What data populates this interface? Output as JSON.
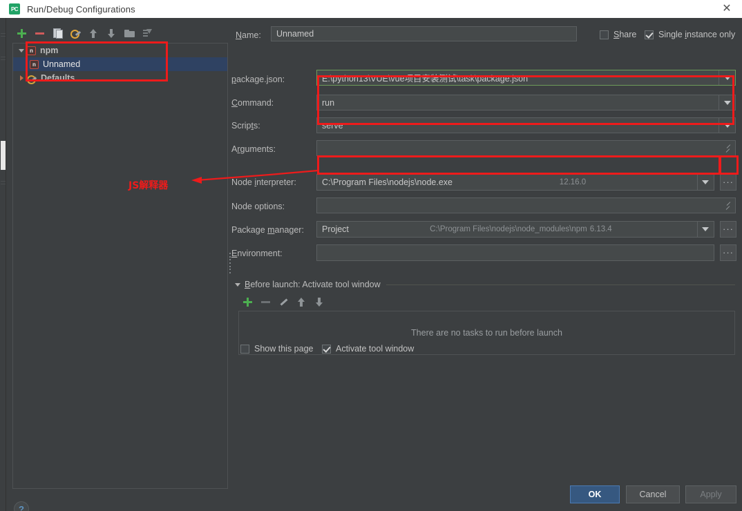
{
  "window": {
    "title": "Run/Debug Configurations",
    "app_icon": "pycharm-icon",
    "app_icon_text": "PC",
    "close_icon": "✕"
  },
  "left_panel": {
    "toolbar": [
      {
        "name": "add-configuration-button",
        "icon": "plus-icon"
      },
      {
        "name": "remove-configuration-button",
        "icon": "minus-icon"
      },
      {
        "name": "copy-configuration-button",
        "icon": "copy-icon"
      },
      {
        "name": "edit-defaults-button",
        "icon": "wrench-icon"
      },
      {
        "name": "move-up-button",
        "icon": "arrow-up-icon"
      },
      {
        "name": "move-down-button",
        "icon": "arrow-down-icon"
      },
      {
        "name": "new-folder-button",
        "icon": "folder-icon"
      },
      {
        "name": "sort-configurations-button",
        "icon": "sort-icon"
      }
    ],
    "tree": [
      {
        "label": "npm",
        "icon": "npm-icon",
        "expander": "caret-down-icon",
        "selected": false,
        "level": 0
      },
      {
        "label": "Unnamed",
        "icon": "npm-icon",
        "expander": "none",
        "selected": true,
        "level": 1
      },
      {
        "label": "Defaults",
        "icon": "defaults-wrench-icon",
        "expander": "caret-right-icon",
        "selected": false,
        "level": 0
      }
    ]
  },
  "form": {
    "name_label": "Name:",
    "name_label_mnemonic": "N",
    "name_value": "Unnamed",
    "share_label": "Share",
    "share_checked": false,
    "single_instance_label": "Single instance only",
    "single_instance_checked": true,
    "rows": [
      {
        "label": "package.json:",
        "mnemonic": "p",
        "value": "E:\\python13\\VUE\\vue项目安装测试\\task\\package.json",
        "hint": "",
        "control": "combo"
      },
      {
        "label": "Command:",
        "mnemonic": "C",
        "value": "run",
        "hint": "",
        "control": "combo"
      },
      {
        "label": "Scripts:",
        "mnemonic": "t",
        "value": "serve",
        "hint": "",
        "control": "combo"
      },
      {
        "label": "Arguments:",
        "mnemonic": "r",
        "value": "",
        "hint": "",
        "control": "expandable"
      },
      {
        "label": "Node interpreter:",
        "mnemonic": "i",
        "value": "C:\\Program Files\\nodejs\\node.exe",
        "hint": "12.16.0",
        "control": "combo-browse"
      },
      {
        "label": "Node options:",
        "mnemonic": "",
        "value": "",
        "hint": "",
        "control": "expandable"
      },
      {
        "label": "Package manager:",
        "mnemonic": "m",
        "value": "Project",
        "hint": "C:\\Program Files\\nodejs\\node_modules\\npm",
        "hint2": "6.13.4",
        "control": "combo-browse"
      },
      {
        "label": "Environment:",
        "mnemonic": "E",
        "value": "",
        "hint": "",
        "control": "browse"
      }
    ]
  },
  "before_launch": {
    "title": "Before launch: Activate tool window",
    "title_mnemonic": "B",
    "toolbar": [
      {
        "name": "add-task-button",
        "icon": "plus-icon"
      },
      {
        "name": "remove-task-button",
        "icon": "minus-icon"
      },
      {
        "name": "edit-task-button",
        "icon": "pencil-icon"
      },
      {
        "name": "move-task-up-button",
        "icon": "arrow-up-icon"
      },
      {
        "name": "move-task-down-button",
        "icon": "arrow-down-icon"
      }
    ],
    "empty_text": "There are no tasks to run before launch",
    "show_page_label": "Show this page",
    "show_page_checked": false,
    "activate_tool_window_label": "Activate tool window",
    "activate_tool_window_checked": true
  },
  "footer": {
    "help_icon": "question-mark-icon",
    "ok_label": "OK",
    "cancel_label": "Cancel",
    "apply_label": "Apply"
  },
  "annotations": {
    "note_text": "JS解释器",
    "color": "#ee1b1b"
  },
  "colors": {
    "background": "#3c3f41",
    "field_background": "#45494a",
    "selection": "#2f4262",
    "accent": "#365880",
    "annotation_red": "#ee1b1b",
    "titlebar": "#ffffff"
  }
}
